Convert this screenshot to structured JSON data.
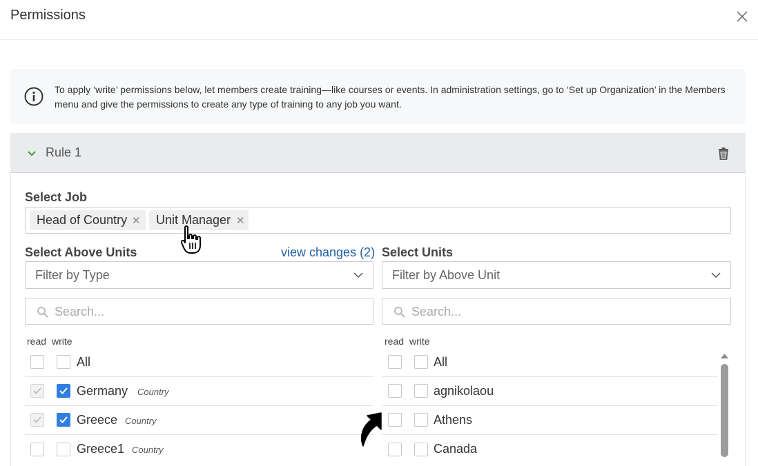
{
  "dialog": {
    "title": "Permissions"
  },
  "info": {
    "text": "To apply ‘write’ permissions below, let members create training—like courses or events. In administration settings, go to ‘Set up Organization’ in the Members menu and give the permissions to create any type of training to any job you want."
  },
  "rule": {
    "title": "Rule 1"
  },
  "job": {
    "label": "Select Job",
    "tags": [
      "Head of Country",
      "Unit Manager"
    ]
  },
  "above_units": {
    "label": "Select Above Units",
    "view_changes": "view changes (2)",
    "filter_placeholder": "Filter by Type",
    "search_placeholder": "Search...",
    "read_label": "read",
    "write_label": "write",
    "all_label": "All",
    "rows": [
      {
        "name": "Germany",
        "type": "Country",
        "read": true,
        "write": true
      },
      {
        "name": "Greece",
        "type": "Country",
        "read": true,
        "write": true
      },
      {
        "name": "Greece1",
        "type": "Country",
        "read": false,
        "write": false
      }
    ]
  },
  "units": {
    "label": "Select Units",
    "filter_placeholder": "Filter by Above Unit",
    "search_placeholder": "Search...",
    "read_label": "read",
    "write_label": "write",
    "all_label": "All",
    "rows": [
      {
        "name": "agnikolaou",
        "read": false,
        "write": false
      },
      {
        "name": "Athens",
        "read": false,
        "write": false
      },
      {
        "name": "Canada",
        "read": false,
        "write": false
      }
    ]
  },
  "colors": {
    "accent": "#2f7fe0",
    "link": "#1f5fa8",
    "rule_chevron": "#3aa135"
  }
}
